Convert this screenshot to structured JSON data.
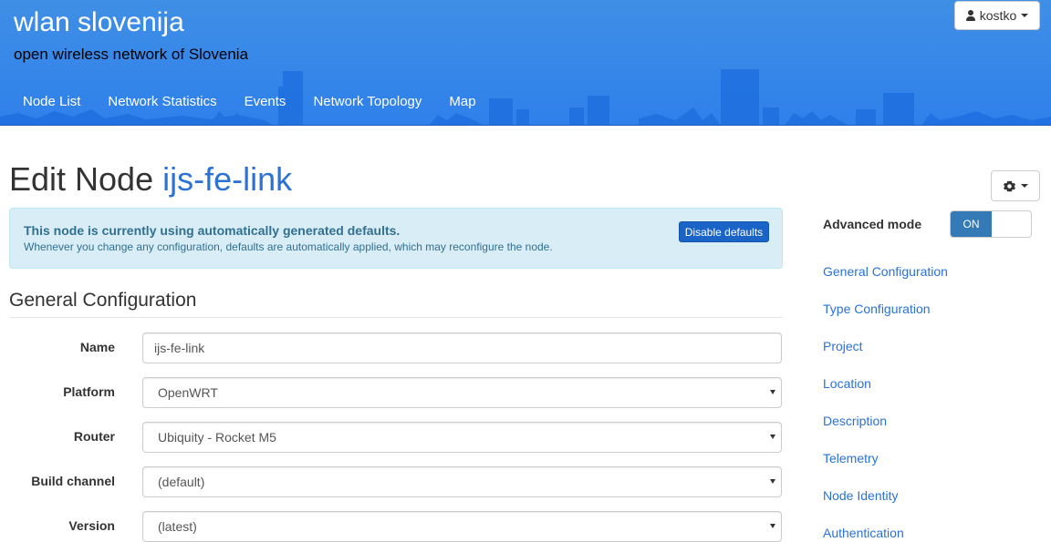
{
  "header": {
    "site_title": "wlan slovenija",
    "site_subtitle": "open wireless network of Slovenia",
    "nav": [
      "Node List",
      "Network Statistics",
      "Events",
      "Network Topology",
      "Map"
    ],
    "user": {
      "name": "kostko",
      "icon": "user-icon"
    }
  },
  "page": {
    "title_prefix": "Edit Node",
    "node_name": "ijs-fe-link"
  },
  "alert": {
    "title": "This node is currently using automatically generated defaults.",
    "text": "Whenever you change any configuration, defaults are automatically applied, which may reconfigure the node.",
    "button": "Disable defaults"
  },
  "section": {
    "title": "General Configuration"
  },
  "form": {
    "name": {
      "label": "Name",
      "value": "ijs-fe-link"
    },
    "platform": {
      "label": "Platform",
      "value": "OpenWRT"
    },
    "router": {
      "label": "Router",
      "value": "Ubiquity - Rocket M5"
    },
    "build_channel": {
      "label": "Build channel",
      "value": "(default)"
    },
    "version": {
      "label": "Version",
      "value": "(latest)"
    }
  },
  "sidebar": {
    "gear_icon": "gear-icon",
    "advanced_mode_label": "Advanced mode",
    "toggle_state": "ON",
    "links": [
      "General Configuration",
      "Type Configuration",
      "Project",
      "Location",
      "Description",
      "Telemetry",
      "Node Identity",
      "Authentication"
    ]
  },
  "colors": {
    "header_blue": "#2f80ea",
    "link_blue": "#2a72d6",
    "alert_bg": "#d9edf7",
    "toggle_on": "#337ab7"
  }
}
